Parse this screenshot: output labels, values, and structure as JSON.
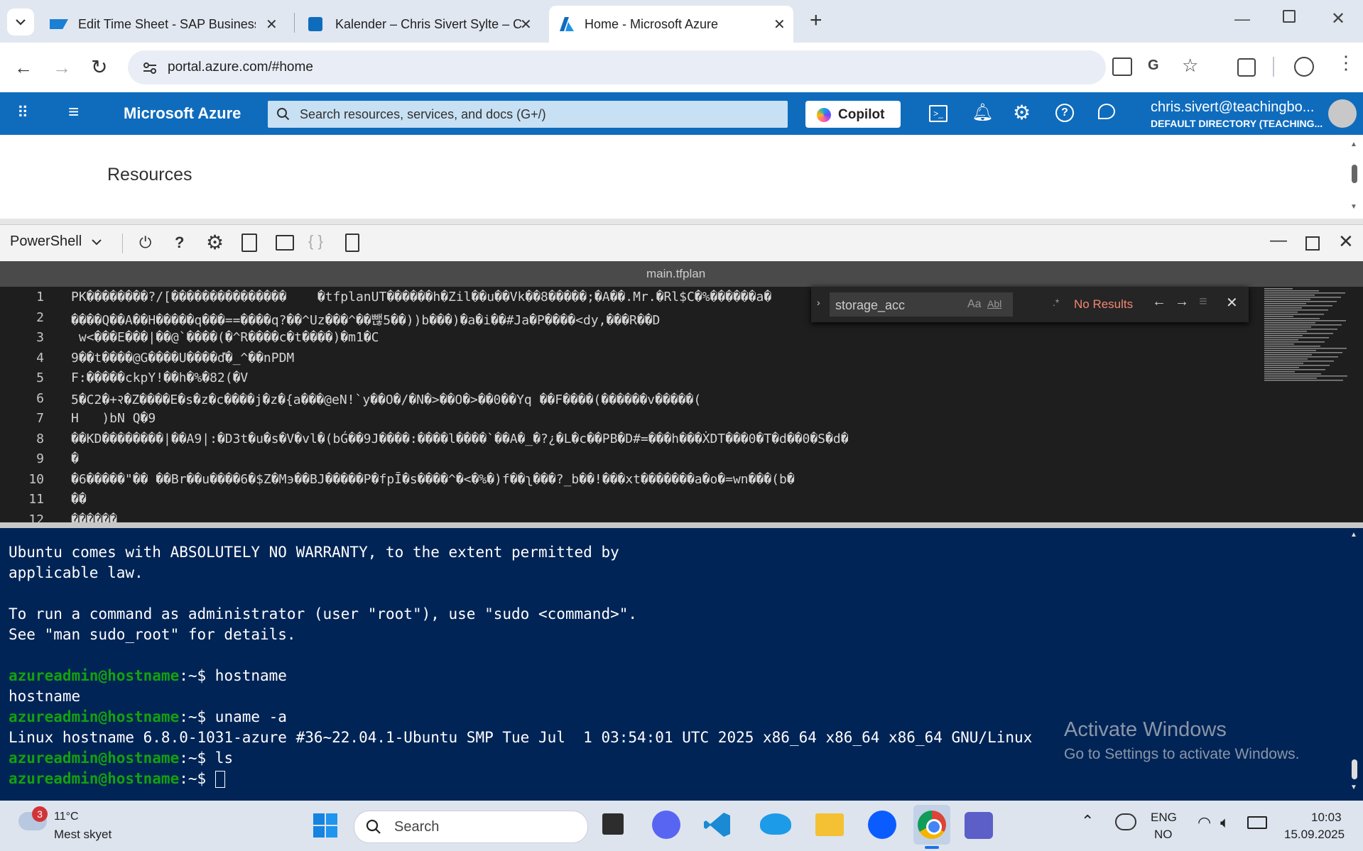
{
  "browser": {
    "tabs": [
      {
        "title": "Edit Time Sheet - SAP Business",
        "icon": "sap-icon"
      },
      {
        "title": "Kalender – Chris Sivert Sylte – C",
        "icon": "outlook-icon"
      },
      {
        "title": "Home - Microsoft Azure",
        "icon": "azure-icon"
      }
    ],
    "new_tab": "+",
    "url": "portal.azure.com/#home"
  },
  "azure": {
    "brand": "Microsoft Azure",
    "search_placeholder": "Search resources, services, and docs (G+/)",
    "copilot_label": "Copilot",
    "user_email": "chris.sivert@teachingbo...",
    "user_directory": "DEFAULT DIRECTORY (TEACHING...",
    "section_title": "Resources"
  },
  "shell": {
    "type_label": "PowerShell",
    "editor_filename": "main.tfplan",
    "find": {
      "query": "storage_acc",
      "result": "No Results",
      "case_label": "Aa",
      "word_label": "Abl",
      "regex_label": ".*"
    },
    "lines": [
      {
        "n": "1",
        "text": "PK��������?/[���������������    �tfplanUT������h�Zil��u��Vk��8�����;�A��.Mr.�Rl$C�%������a�"
      },
      {
        "n": "2",
        "text": "����Q��A��H�����q���==����q?��^Uz���^��뺂5��))b���)�a�i��#Ja�P����<dy,���R��D"
      },
      {
        "n": "3",
        "text": " w<���E���|��@`����(�^R����c�t����)�m1�C"
      },
      {
        "n": "4",
        "text": "9��t����@G����U����ď�_^��nPDM"
      },
      {
        "n": "5",
        "text": "F:�����ckpY!��h�%�82(�V"
      },
      {
        "n": "6",
        "text": "5�C2�+२�Z����E�s�z�c����j�z�{a���@eN!`y��O�/�N�>��O�>��0��Yq ��F����(������v�����("
      },
      {
        "n": "7",
        "text": "H   )bN Q�9"
      },
      {
        "n": "8",
        "text": "��KD��������|��A9|:�D3t�u�s�V�vl�(bǴ��9J����:����l����`��A�_�?¿�L�c��PB�D#=���h���ẊDT���0�T�d��0�S�d�"
      },
      {
        "n": "9",
        "text": "�"
      },
      {
        "n": "10",
        "text": "�6�����\"�� ��Br��u����6�$Z�Mэ��BJ�����P�fpĪ�s����^�<�%�)f��ʅ���?_b��!���xt�������a�o�=wn���(b�"
      },
      {
        "n": "11",
        "text": "��"
      },
      {
        "n": "12",
        "text": "������"
      }
    ],
    "terminal": [
      {
        "text": "Ubuntu comes with ABSOLUTELY NO WARRANTY, to the extent permitted by",
        "prompt": false
      },
      {
        "text": "applicable law.",
        "prompt": false
      },
      {
        "text": "",
        "prompt": false
      },
      {
        "text": "To run a command as administrator (user \"root\"), use \"sudo <command>\".",
        "prompt": false
      },
      {
        "text": "See \"man sudo_root\" for details.",
        "prompt": false
      },
      {
        "text": "",
        "prompt": false
      },
      {
        "prompt": true,
        "user": "azureadmin@hostname",
        "path": ":~$ ",
        "cmd": "hostname"
      },
      {
        "text": "hostname",
        "prompt": false
      },
      {
        "prompt": true,
        "user": "azureadmin@hostname",
        "path": ":~$ ",
        "cmd": "uname -a"
      },
      {
        "text": "Linux hostname 6.8.0-1031-azure #36~22.04.1-Ubuntu SMP Tue Jul  1 03:54:01 UTC 2025 x86_64 x86_64 x86_64 GNU/Linux",
        "prompt": false
      },
      {
        "prompt": true,
        "user": "azureadmin@hostname",
        "path": ":~$ ",
        "cmd": "ls"
      },
      {
        "prompt": true,
        "user": "azureadmin@hostname",
        "path": ":~$ ",
        "cmd": ""
      }
    ],
    "prompt_user_color": "#13a10e"
  },
  "watermark": {
    "line1": "Activate Windows",
    "line2": "Go to Settings to activate Windows."
  },
  "taskbar": {
    "weather_temp": "11°C",
    "weather_desc": "Mest skyet",
    "weather_badge": "3",
    "search_label": "Search",
    "lang_top": "ENG",
    "lang_bottom": "NO",
    "time": "10:03",
    "date": "15.09.2025"
  },
  "colors": {
    "azure_blue": "#0f6cbd",
    "terminal_bg": "#012456",
    "find_no_results": "#f48771"
  }
}
